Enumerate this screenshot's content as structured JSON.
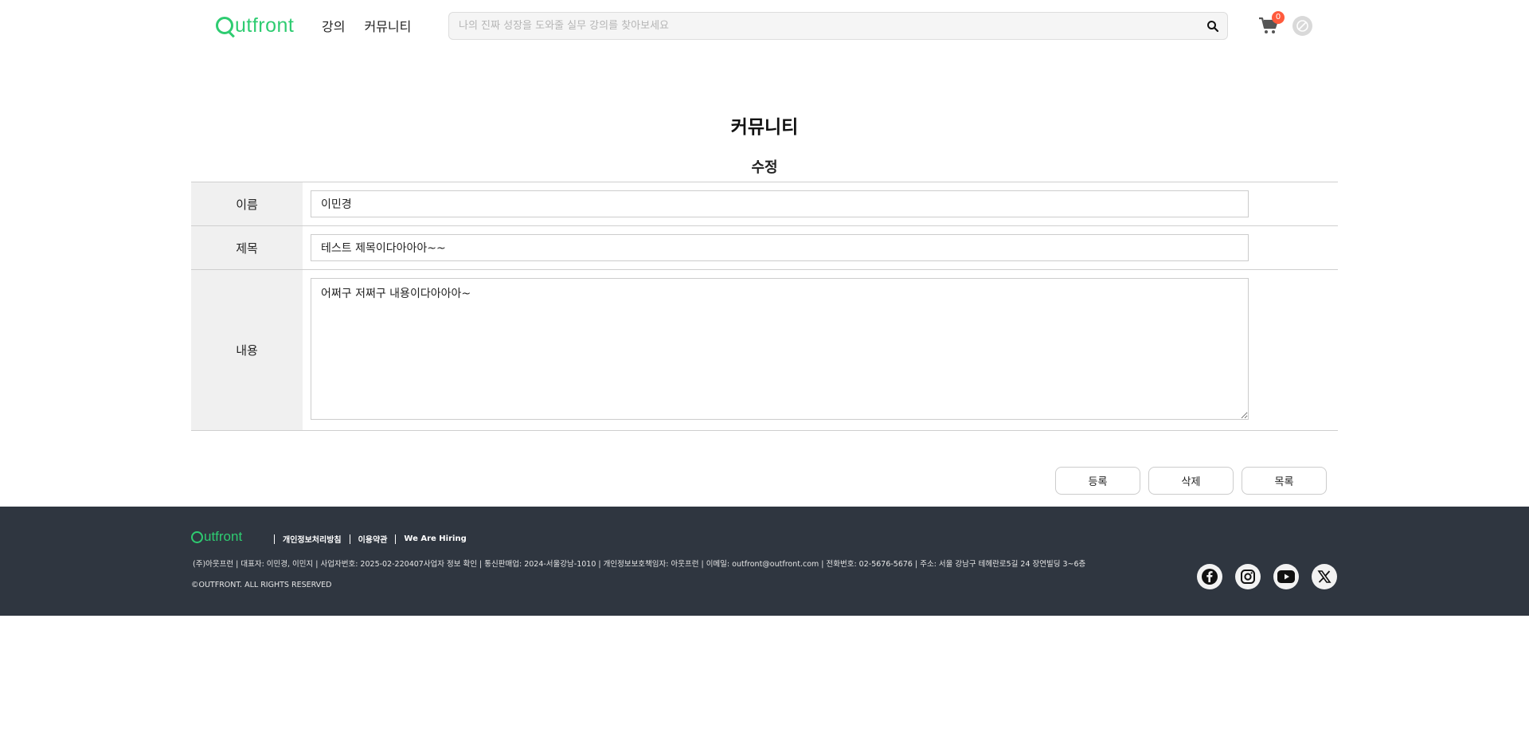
{
  "header": {
    "logo_text": "utfront",
    "nav": [
      "강의",
      "커뮤니티"
    ],
    "search_placeholder": "나의 진짜 성장을 도와줄 실무 강의를 찾아보세요",
    "cart_count": "0"
  },
  "main": {
    "title": "커뮤니티",
    "subtitle": "수정",
    "fields": {
      "name_label": "이름",
      "name_value": "이민경",
      "title_label": "제목",
      "title_value": "테스트 제목이다아아아~~",
      "content_label": "내용",
      "content_value": "어쩌구 저쩌구 내용이다아아아~"
    },
    "buttons": {
      "submit": "등록",
      "delete": "삭제",
      "list": "목록"
    }
  },
  "footer": {
    "logo_text": "utfront",
    "links": [
      "개인정보처리방침",
      "이용약관",
      "We Are Hiring"
    ],
    "company_info": "(주)아웃프런 |  대표자: 이민경, 이민지 |  사업자번호: 2025-02-220407사업자 정보 확인 | 통신판매업: 2024-서울강남-1010 |  개인정보보호책임자: 아웃프런 |  이메일: outfront@outfront.com | 전화번호: 02-5676-5676 |  주소: 서울 강남구 테헤란로5길 24 장연빌딩 3~6층",
    "copyright": "©OUTFRONT. ALL RIGHTS RESERVED",
    "socials": [
      "facebook-icon",
      "instagram-icon",
      "youtube-icon",
      "x-icon"
    ]
  },
  "colors": {
    "brand": "#2ecc71",
    "footer_bg": "#2f3640",
    "badge": "#ff5a3c"
  }
}
